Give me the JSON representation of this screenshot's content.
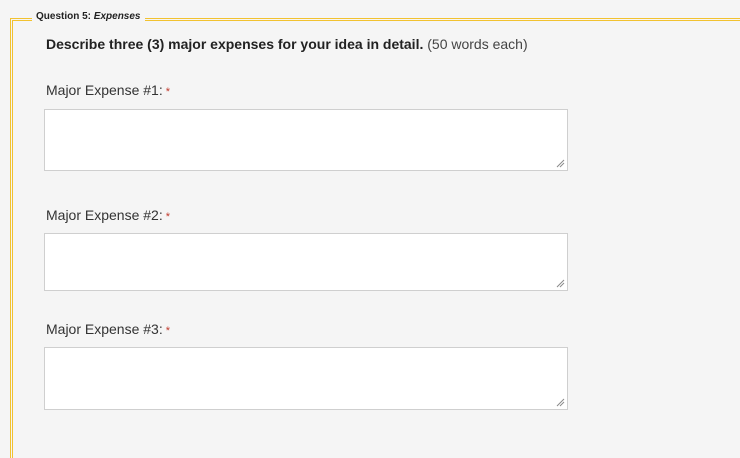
{
  "section": {
    "legend_prefix": "Question 5:",
    "legend_title": "Expenses",
    "description_strong": "Describe three (3) major expenses for your idea in detail.",
    "description_note": "(50 words each)"
  },
  "fields": [
    {
      "label": "Major Expense #1:",
      "required_marker": "*",
      "value": ""
    },
    {
      "label": "Major Expense #2:",
      "required_marker": "*",
      "value": ""
    },
    {
      "label": "Major Expense #3:",
      "required_marker": "*",
      "value": ""
    }
  ],
  "colors": {
    "accent_border": "#f2c230",
    "required": "#c0392b",
    "background": "#f5f5f5"
  },
  "icons": {
    "resize": "resize-grip-icon"
  }
}
